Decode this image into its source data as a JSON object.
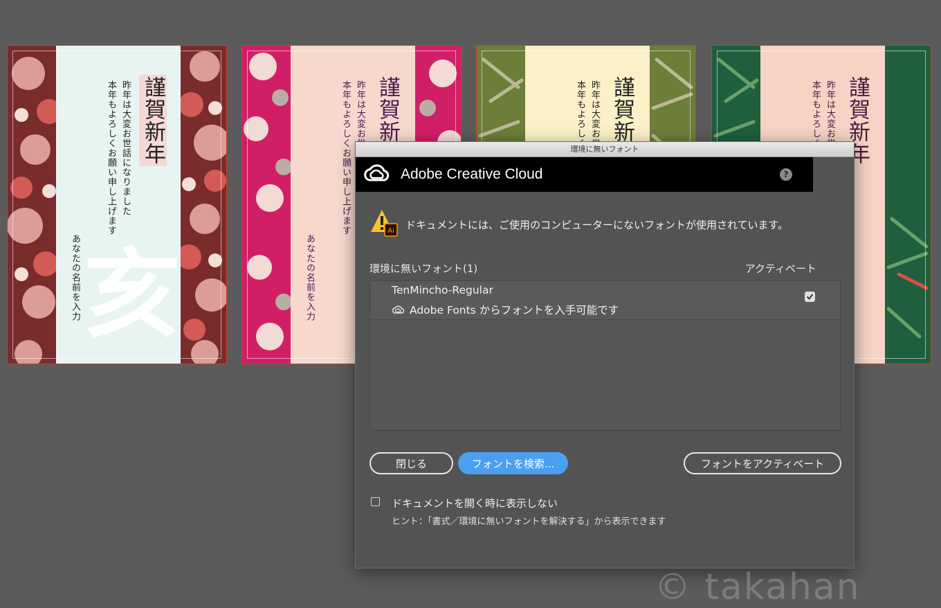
{
  "artboards": [
    {
      "title": "謹賀新年",
      "line1": "昨年は大変お世話になりました",
      "line2": "本年もよろしくお願い申し上げます",
      "name": "あなたの名前を入力",
      "big_char": "亥",
      "bg": "#7a2b2b",
      "band": "#e8f4f2",
      "text_color": "#222"
    },
    {
      "title": "謹賀新",
      "line1": "昨年は大変お世",
      "line2": "本年もよろしくお願い申し上げます",
      "name": "あなたの名前を入力",
      "bg": "#d11f67",
      "band": "#f6d9cc",
      "text_color": "#4a1a55"
    },
    {
      "title": "謹賀新",
      "line1": "昨年は大変お世",
      "line2": "本年もよろしく",
      "bg": "#6d7d3a",
      "band": "#fbf0c8",
      "text_color": "#222"
    },
    {
      "title": "謹賀新年",
      "line1": "昨年は大変お世",
      "line2": "本年もよろしく",
      "bg": "#1f5f3d",
      "band": "#f6d3c4",
      "text_color": "#4a1a40"
    }
  ],
  "dialog": {
    "window_title": "環境に無いフォント",
    "banner_title": "Adobe Creative Cloud",
    "help_label": "?",
    "warning_icon": "warning-illustrator-icon",
    "warning_text": "ドキュメントには、ご使用のコンピューターにないフォントが使用されています。",
    "missing_label": "環境に無いフォント(1)",
    "activate_col": "アクティベート",
    "fonts": [
      {
        "name": "TenMincho-Regular",
        "source": "Adobe Fonts からフォントを入手可能です",
        "checked": true
      }
    ],
    "buttons": {
      "close": "閉じる",
      "search": "フォントを検索...",
      "activate": "フォントをアクティベート"
    },
    "dont_show": "ドキュメントを開く時に表示しない",
    "hint": "ヒント：「書式／環境に無いフォントを解決する」から表示できます",
    "accent": "#4a9ff0"
  },
  "watermark": "© takahan"
}
